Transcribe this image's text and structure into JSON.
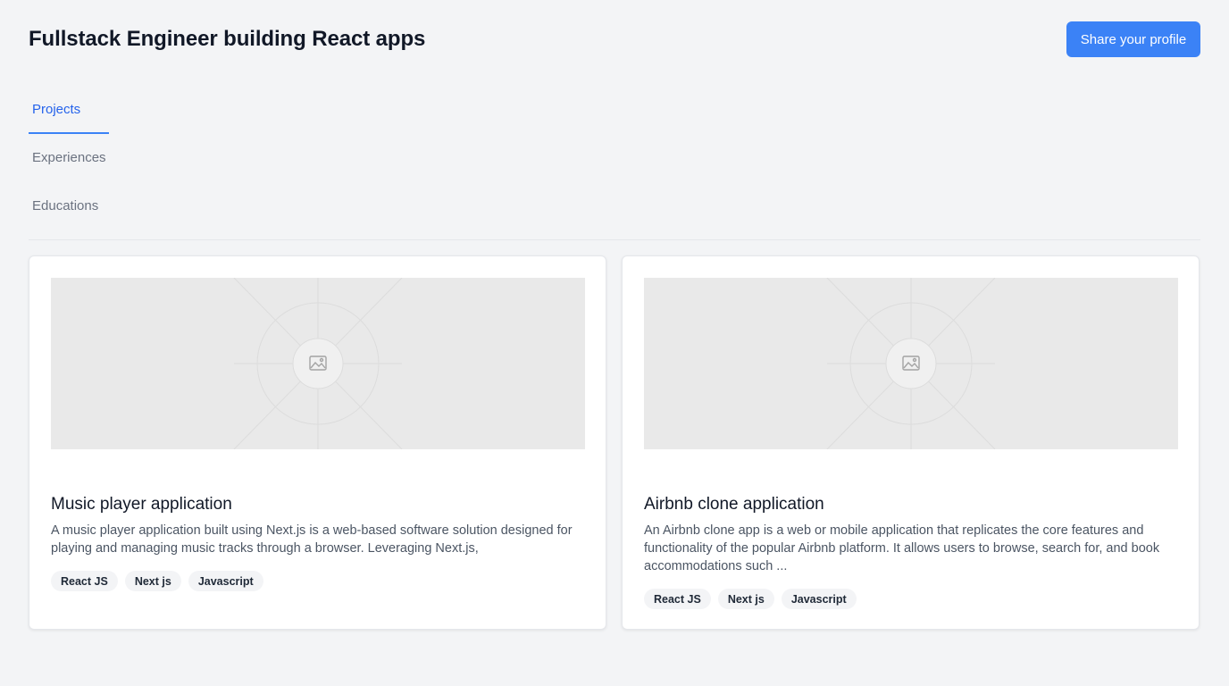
{
  "header": {
    "title": "Fullstack Engineer building React apps",
    "share_label": "Share your profile"
  },
  "tabs": [
    {
      "label": "Projects",
      "active": true
    },
    {
      "label": "Experiences",
      "active": false
    },
    {
      "label": "Educations",
      "active": false
    }
  ],
  "projects": [
    {
      "title": "Music player application",
      "description": "A music player application built using Next.js is a web-based software solution designed for playing and managing music tracks through a browser. Leveraging Next.js,",
      "tags": [
        "React JS",
        "Next js",
        "Javascript"
      ],
      "image_icon": "image-placeholder-icon"
    },
    {
      "title": "Airbnb clone application",
      "description": "An Airbnb clone app is a web or mobile application that replicates the core features and functionality of the popular Airbnb platform. It allows users to browse, search for, and book accommodations such ...",
      "tags": [
        "React JS",
        "Next js",
        "Javascript"
      ],
      "image_icon": "image-placeholder-icon"
    }
  ],
  "colors": {
    "accent": "#3b82f6",
    "background": "#f3f4f6",
    "card": "#ffffff",
    "placeholder": "#e9e9e9"
  }
}
